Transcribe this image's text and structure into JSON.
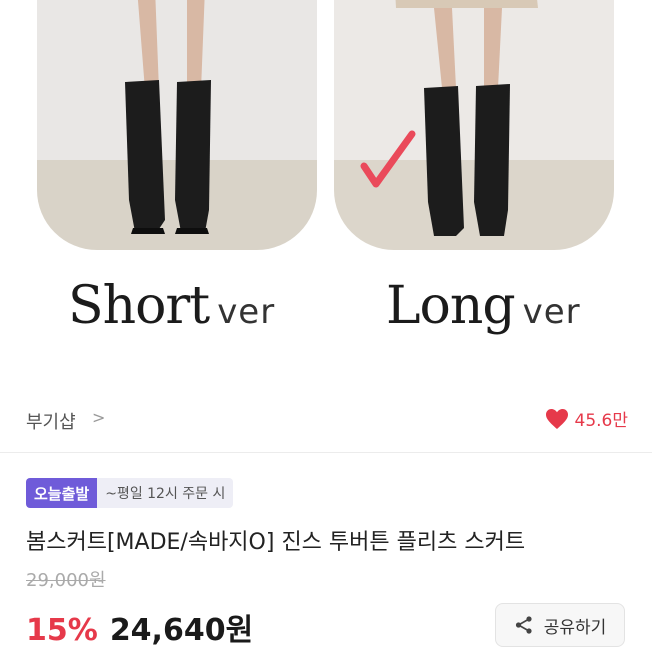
{
  "hero": {
    "short_label": "Short",
    "short_suffix": "ver",
    "long_label": "Long",
    "long_suffix": "ver"
  },
  "store": {
    "name": "부기샵",
    "chevron": ">",
    "likes": "45.6만"
  },
  "badges": {
    "today": "오늘출발",
    "cutoff": "~평일 12시 주문 시"
  },
  "product": {
    "title": "봄스커트[MADE/속바지O] 진스 투버튼 플리츠 스커트",
    "original_price": "29,000원",
    "discount": "15%",
    "price": "24,640원"
  },
  "share": {
    "label": "공유하기",
    "icon": "share-icon"
  },
  "colors": {
    "accent_red": "#e6394a",
    "badge_purple": "#6f5bd9"
  }
}
